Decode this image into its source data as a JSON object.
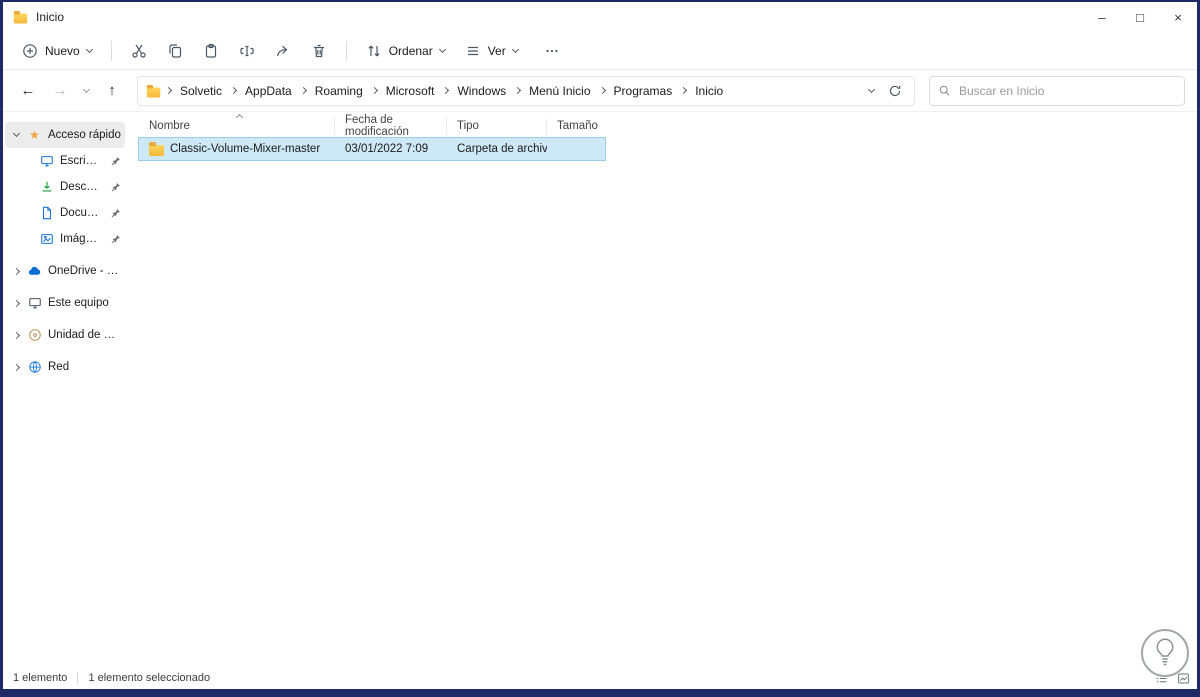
{
  "titlebar": {
    "title": "Inicio",
    "minimize_glyph": "–",
    "maximize_glyph": "□",
    "close_glyph": "×"
  },
  "toolbar": {
    "new_label": "Nuevo",
    "sort_label": "Ordenar",
    "view_label": "Ver"
  },
  "navbar": {
    "back_glyph": "←",
    "forward_glyph": "→",
    "up_glyph": "↑",
    "breadcrumb": [
      "Solvetic",
      "AppData",
      "Roaming",
      "Microsoft",
      "Windows",
      "Menú Inicio",
      "Programas",
      "Inicio"
    ],
    "search_placeholder": "Buscar en Inicio"
  },
  "sidebar": {
    "items": [
      {
        "label": "Acceso rápido"
      },
      {
        "label": "Escritorio"
      },
      {
        "label": "Descargas"
      },
      {
        "label": "Documentos"
      },
      {
        "label": "Imágenes"
      },
      {
        "label": "OneDrive - Personal"
      },
      {
        "label": "Este equipo"
      },
      {
        "label": "Unidad de DVD (D:)"
      },
      {
        "label": "Red"
      }
    ]
  },
  "table": {
    "columns": [
      "Nombre",
      "Fecha de modificación",
      "Tipo",
      "Tamaño"
    ],
    "rows": [
      {
        "name": "Classic-Volume-Mixer-master",
        "modified": "03/01/2022 7:09",
        "type": "Carpeta de archivos",
        "size": ""
      }
    ]
  },
  "statusbar": {
    "item_count": "1 elemento",
    "selection_count": "1 elemento seleccionado"
  },
  "colors": {
    "selection_bg": "#cde8f7",
    "selection_border": "#9ccdeb",
    "frame": "#1e2a66"
  }
}
